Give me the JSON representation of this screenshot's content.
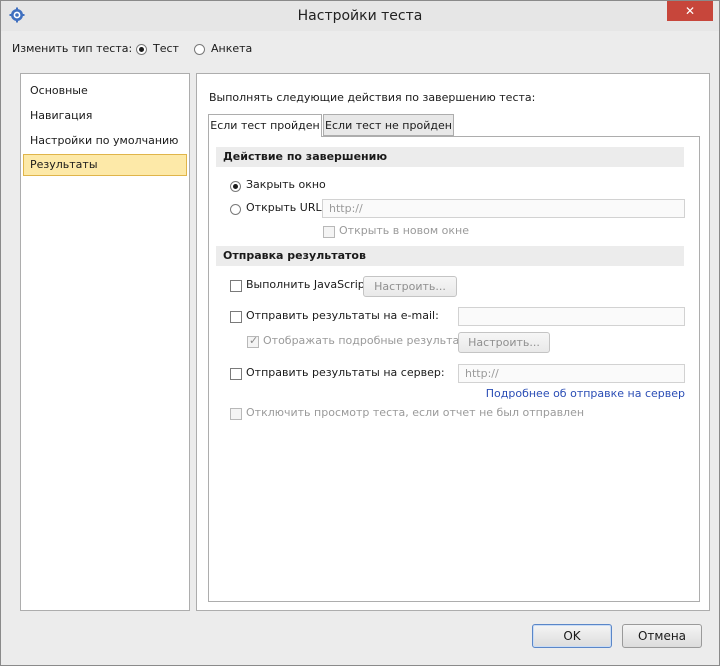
{
  "window": {
    "title": "Настройки теста",
    "close_glyph": "✕"
  },
  "test_type": {
    "label": "Изменить тип теста:",
    "options": [
      {
        "label": "Тест",
        "selected": true
      },
      {
        "label": "Анкета",
        "selected": false
      }
    ]
  },
  "sidebar": {
    "items": [
      {
        "label": "Основные",
        "active": false
      },
      {
        "label": "Навигация",
        "active": false
      },
      {
        "label": "Настройки по умолчанию",
        "active": false
      },
      {
        "label": "Результаты",
        "active": true
      }
    ]
  },
  "content": {
    "intro": "Выполнять следующие действия по завершению теста:",
    "tabs": [
      {
        "label": "Если тест пройден",
        "active": true
      },
      {
        "label": "Если тест не пройден",
        "active": false
      }
    ],
    "finish_section": {
      "header": "Действие по завершению",
      "close_window_label": "Закрыть окно",
      "open_url_label": "Открыть URL:",
      "url_placeholder": "http://",
      "new_window_label": "Открыть в новом окне"
    },
    "send_section": {
      "header": "Отправка результатов",
      "js_label": "Выполнить JavaScript",
      "js_configure": "Настроить...",
      "email_label": "Отправить результаты на e-mail:",
      "email_value": "",
      "detailed_label": "Отображать подробные результаты",
      "email_configure": "Настроить...",
      "server_label": "Отправить результаты на сервер:",
      "server_placeholder": "http://",
      "server_link": "Подробнее об отправке на сервер",
      "disable_view_label": "Отключить просмотр теста, если отчет не был отправлен"
    }
  },
  "footer": {
    "ok": "OK",
    "cancel": "Отмена"
  },
  "colors": {
    "close_button": "#c7463b",
    "selected_item": "#fde9a8",
    "link": "#2a4db5"
  }
}
